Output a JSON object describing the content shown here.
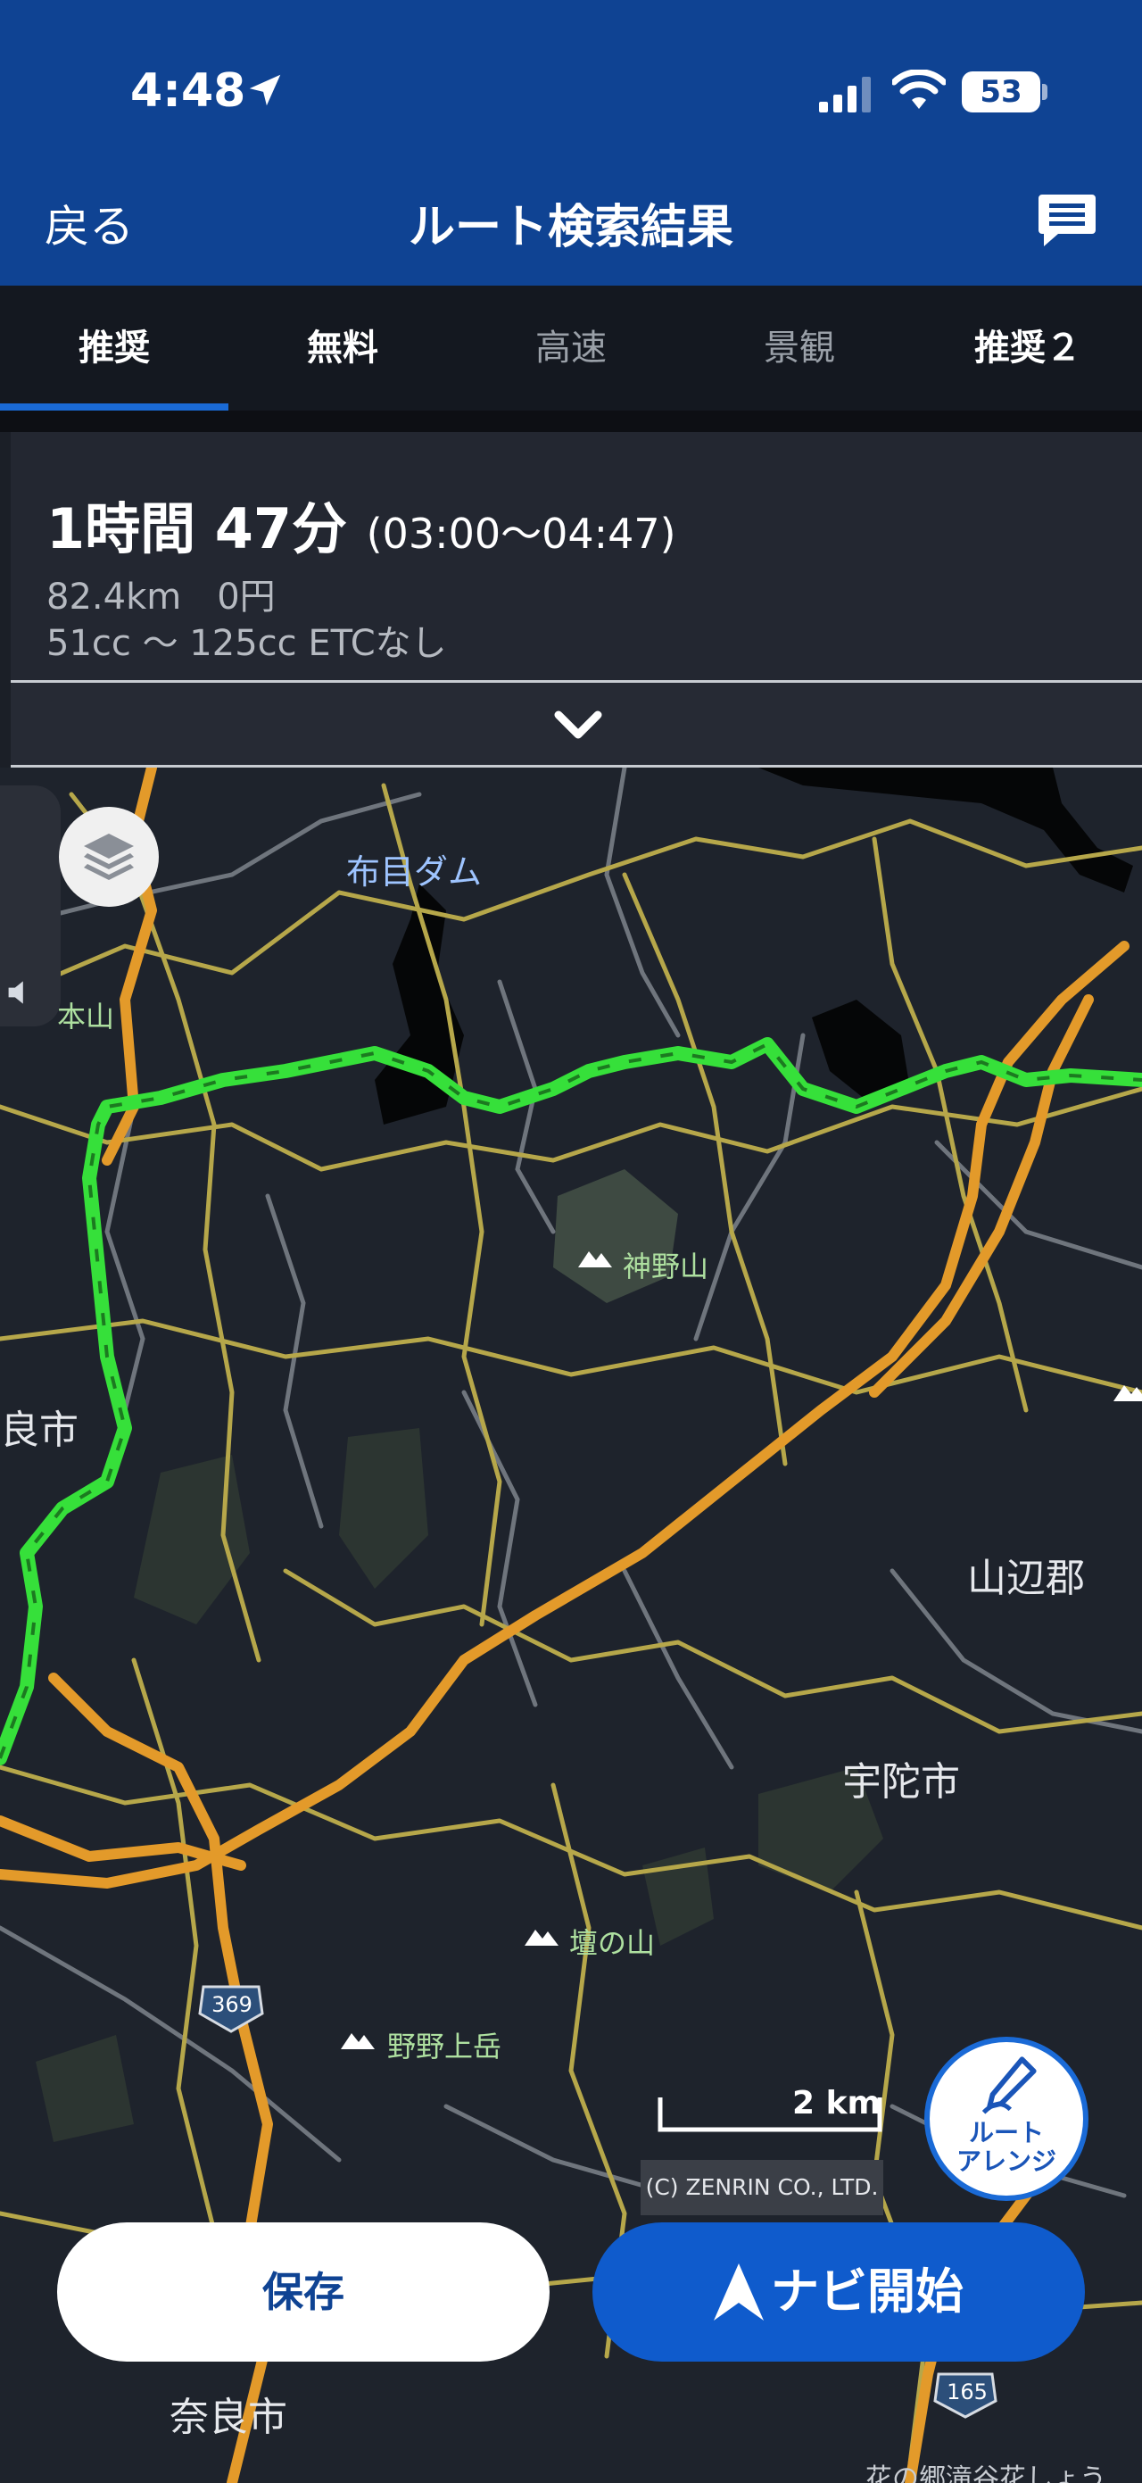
{
  "status": {
    "time": "4:48",
    "battery": "53"
  },
  "nav": {
    "back": "戻る",
    "title": "ルート検索結果"
  },
  "tabs": [
    {
      "label": "推奨",
      "active": true
    },
    {
      "label": "無料",
      "active": false
    },
    {
      "label": "高速",
      "active": false,
      "dim": true
    },
    {
      "label": "景観",
      "active": false,
      "dim": true
    },
    {
      "label": "推奨２",
      "active": false
    }
  ],
  "summary": {
    "duration": "1時間 47分",
    "timespan": "(03:00～04:47)",
    "distance_cost": "82.4km　0円",
    "vehicle": "51cc ～ 125cc ETCなし"
  },
  "map": {
    "labels": {
      "dam": "布目ダム",
      "honzan": "本山",
      "kannoyama": "神野山",
      "nara_left": "良市",
      "yamabe": "山辺郡",
      "uda": "宇陀市",
      "dannoyama": "壇の山",
      "nonoue": "野野上岳",
      "nara": "奈良市",
      "hana": "花の郷滝谷花しょう",
      "route369": "369",
      "route165": "165"
    },
    "scale_label": "2 km",
    "copyright": "(C) ZENRIN CO., LTD."
  },
  "arrange": {
    "label_line1": "ルート",
    "label_line2": "アレンジ"
  },
  "actions": {
    "save": "保存",
    "navi": "ナビ開始"
  },
  "colors": {
    "header": "#0f4393",
    "route": "#36e03a",
    "highway": "#e39a2a",
    "accent": "#1a6ad6"
  }
}
